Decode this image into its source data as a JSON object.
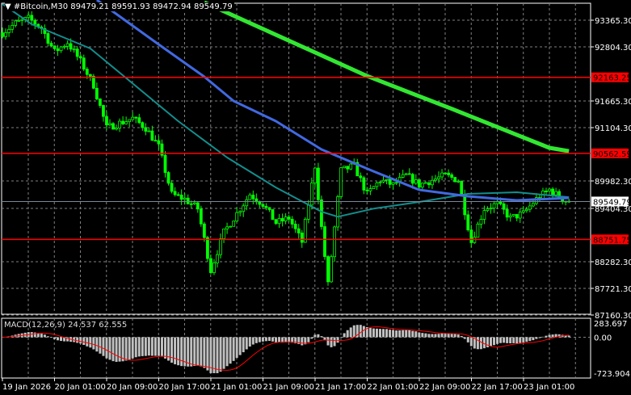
{
  "header": {
    "symbol": "#Bitcoin,M30",
    "ohlc": "89479.21 89591.93 89472.94 89549.79",
    "menu_icon": "triangle-down-icon"
  },
  "indicator": {
    "label": "MACD(12,26,9) 24.537 62.555",
    "axis": [
      "283.697",
      "0.00",
      "-723.904"
    ]
  },
  "colors": {
    "background": "#000000",
    "candle": "#00ff00",
    "level": "#ff0000",
    "ma_long": "#32e632",
    "ma_mid": "#4169e1",
    "ma_short": "#138e8e",
    "macd_hist": "#c0c0c0",
    "macd_signal": "#ff0000",
    "grid": "#808080"
  },
  "chart_data": {
    "type": "candlestick",
    "timeframe": "M30",
    "price_ticks": [
      "93365.30",
      "92804.30",
      "91665.30",
      "91104.30",
      "89982.30",
      "89404.30",
      "88282.30",
      "87721.30",
      "87160.30"
    ],
    "time_ticks": [
      "19 Jan 2026",
      "20 Jan 01:00",
      "20 Jan 09:00",
      "20 Jan 17:00",
      "21 Jan 01:00",
      "21 Jan 09:00",
      "21 Jan 17:00",
      "22 Jan 01:00",
      "22 Jan 09:00",
      "22 Jan 17:00",
      "23 Jan 01:00"
    ],
    "levels": [
      {
        "price": "92163.25"
      },
      {
        "price": "90562.59"
      },
      {
        "price": "88751.75"
      }
    ],
    "current_price": "89549.79",
    "close_path": [
      [
        "19 Jan 17:00",
        93100
      ],
      [
        "19 Jan 19:00",
        93300
      ],
      [
        "19 Jan 21:00",
        93400
      ],
      [
        "19 Jan 23:00",
        93200
      ],
      [
        "20 Jan 01:00",
        92700
      ],
      [
        "20 Jan 03:00",
        92900
      ],
      [
        "20 Jan 05:00",
        92500
      ],
      [
        "20 Jan 07:00",
        92000
      ],
      [
        "20 Jan 09:00",
        91100
      ],
      [
        "20 Jan 11:00",
        91200
      ],
      [
        "20 Jan 13:00",
        91300
      ],
      [
        "20 Jan 15:00",
        91100
      ],
      [
        "20 Jan 17:00",
        90700
      ],
      [
        "20 Jan 19:00",
        89700
      ],
      [
        "20 Jan 21:00",
        89600
      ],
      [
        "20 Jan 23:00",
        89400
      ],
      [
        "21 Jan 01:00",
        88100
      ],
      [
        "21 Jan 03:00",
        88900
      ],
      [
        "21 Jan 05:00",
        89300
      ],
      [
        "21 Jan 07:00",
        89700
      ],
      [
        "21 Jan 09:00",
        89500
      ],
      [
        "21 Jan 11:00",
        89100
      ],
      [
        "21 Jan 13:00",
        89200
      ],
      [
        "21 Jan 15:00",
        88700
      ],
      [
        "21 Jan 17:00",
        90300
      ],
      [
        "21 Jan 18:00",
        89000
      ],
      [
        "21 Jan 19:00",
        87800
      ],
      [
        "21 Jan 21:00",
        90200
      ],
      [
        "21 Jan 23:00",
        90300
      ],
      [
        "22 Jan 01:00",
        89700
      ],
      [
        "22 Jan 03:00",
        90000
      ],
      [
        "22 Jan 05:00",
        89900
      ],
      [
        "22 Jan 07:00",
        90100
      ],
      [
        "22 Jan 09:00",
        89900
      ],
      [
        "22 Jan 11:00",
        90000
      ],
      [
        "22 Jan 13:00",
        90100
      ],
      [
        "22 Jan 15:00",
        90000
      ],
      [
        "22 Jan 17:00",
        88700
      ],
      [
        "22 Jan 19:00",
        89400
      ],
      [
        "22 Jan 21:00",
        89500
      ],
      [
        "22 Jan 23:00",
        89200
      ],
      [
        "23 Jan 01:00",
        89300
      ],
      [
        "23 Jan 03:00",
        89600
      ],
      [
        "23 Jan 05:00",
        89800
      ],
      [
        "23 Jan 07:00",
        89600
      ],
      [
        "23 Jan 08:00",
        89550
      ]
    ],
    "moving_averages": [
      {
        "role": "ma_long",
        "points": [
          [
            "21 Jan 00:00",
            93740
          ],
          [
            "22 Jan 01:00",
            92190
          ],
          [
            "22 Jan 14:00",
            91500
          ],
          [
            "23 Jan 05:00",
            90680
          ],
          [
            "23 Jan 08:00",
            90610
          ]
        ]
      },
      {
        "role": "ma_mid",
        "points": [
          [
            "20 Jan 07:30",
            93790
          ],
          [
            "20 Jan 17:00",
            92855
          ],
          [
            "21 Jan 00:00",
            92175
          ],
          [
            "21 Jan 04:30",
            91665
          ],
          [
            "21 Jan 11:00",
            91240
          ],
          [
            "21 Jan 18:00",
            90645
          ],
          [
            "22 Jan 02:00",
            90185
          ],
          [
            "22 Jan 09:00",
            89795
          ],
          [
            "22 Jan 16:30",
            89660
          ],
          [
            "23 Jan 00:00",
            89575
          ],
          [
            "23 Jan 08:00",
            89625
          ]
        ]
      },
      {
        "role": "ma_short",
        "points": [
          [
            "19 Jan 17:00",
            93705
          ],
          [
            "19 Jan 21:30",
            93280
          ],
          [
            "20 Jan 06:30",
            92770
          ],
          [
            "20 Jan 12:30",
            92090
          ],
          [
            "20 Jan 20:00",
            91240
          ],
          [
            "21 Jan 03:30",
            90475
          ],
          [
            "21 Jan 11:00",
            89845
          ],
          [
            "21 Jan 18:00",
            89335
          ],
          [
            "21 Jan 20:30",
            89230
          ],
          [
            "22 Jan 02:00",
            89400
          ],
          [
            "22 Jan 09:00",
            89540
          ],
          [
            "22 Jan 16:30",
            89710
          ],
          [
            "23 Jan 00:00",
            89745
          ],
          [
            "23 Jan 08:00",
            89640
          ]
        ]
      }
    ],
    "macd": {
      "params": "12,26,9",
      "value": 24.537,
      "signal": 62.555,
      "range": [
        -723.904,
        283.697
      ]
    }
  }
}
